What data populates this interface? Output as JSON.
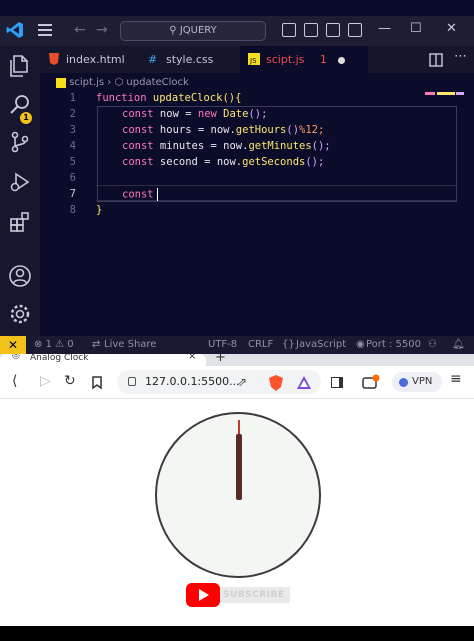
{
  "vscode": {
    "title_search": "JQUERY",
    "tabs": [
      {
        "label": "index.html",
        "icon": "html-file-icon",
        "color": "#e44d26"
      },
      {
        "label": "style.css",
        "icon": "css-file-icon",
        "color": "#42a5f5"
      },
      {
        "label": "scipt.js",
        "icon": "js-file-icon",
        "color": "#f7df1e",
        "modified_count": "1",
        "active": true
      }
    ],
    "breadcrumb": {
      "file": "scipt.js",
      "separator": "›",
      "symbol": "updateClock"
    },
    "activity_badge": "1",
    "line_numbers": [
      "1",
      "2",
      "3",
      "4",
      "5",
      "6",
      "7",
      "8"
    ],
    "code": {
      "l1_kw": "function",
      "l1_fn": "updateClock",
      "l1_rest": "(){",
      "l2_kw": "const",
      "l2_var": " now = ",
      "l2_kw2": "new",
      "l2_fn": " Date",
      "l2_rest": "();",
      "l3_kw": "const",
      "l3_var": " hours = now.",
      "l3_fn": "getHours",
      "l3_rest": "()",
      "l3_num": "%12;",
      "l4_kw": "const",
      "l4_var": " minutes = now.",
      "l4_fn": "getMinutes",
      "l4_rest": "();",
      "l5_kw": "const",
      "l5_var": " second = now.",
      "l5_fn": "getSeconds",
      "l5_rest": "();",
      "l7_kw": "const",
      "l8": "}"
    },
    "status": {
      "remote_icon": "✕",
      "errors": "⊗ 1 ⚠ 0",
      "live_share": "Live Share",
      "encoding": "UTF-8",
      "eol": "CRLF",
      "language": "JavaScript",
      "port": "Port : 5500"
    },
    "colors": {
      "accent": "#f2c21b",
      "keyword": "#ff7ab6",
      "function": "#ffe66d"
    }
  },
  "browser": {
    "tab_title": "Analog Clock",
    "tab_close": "×",
    "new_tab": "+",
    "url": "127.0.0.1:5500...",
    "vpn_label": "VPN",
    "youtube_subscribe": "SUBSCRIBE",
    "icons": [
      "back-icon",
      "forward-icon",
      "reload-icon",
      "bookmark-icon",
      "share-icon",
      "brave-shield-icon",
      "brave-rewards-icon",
      "sidebar-icon",
      "wallet-icon",
      "menu-icon"
    ]
  }
}
